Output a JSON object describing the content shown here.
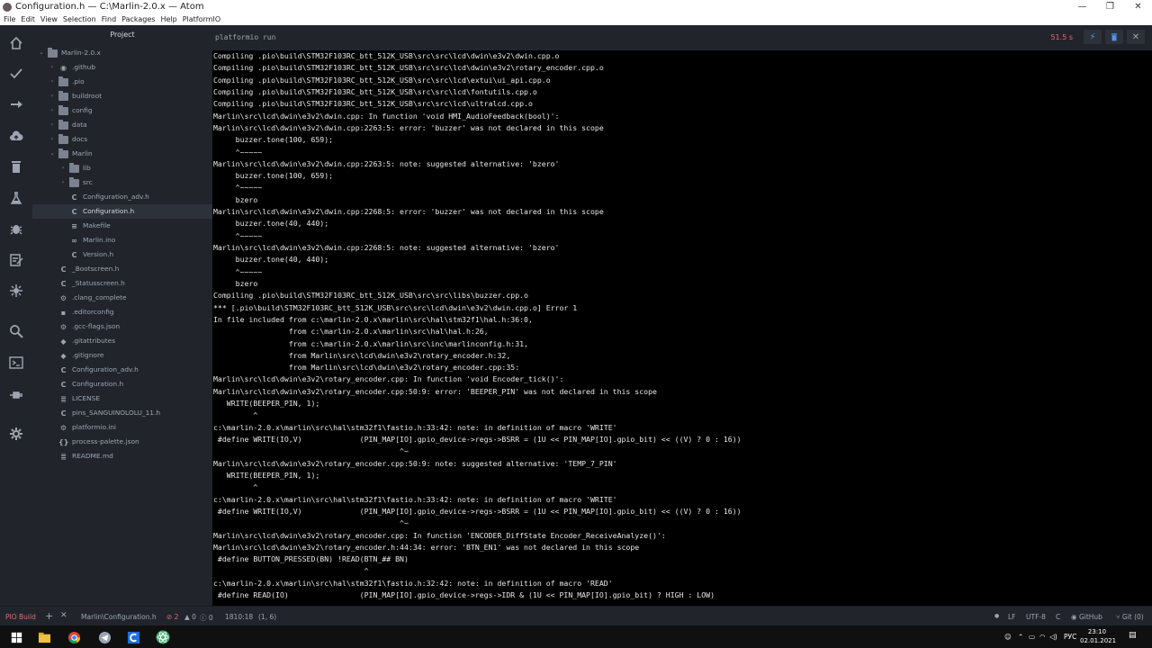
{
  "window": {
    "title": "Configuration.h — C:\\Marlin-2.0.x — Atom",
    "controls": {
      "minimize": "—",
      "maximize": "❐",
      "close": "✕"
    }
  },
  "menu": [
    "File",
    "Edit",
    "View",
    "Selection",
    "Find",
    "Packages",
    "Help",
    "PlatformIO"
  ],
  "activity_icons": [
    "home-icon",
    "check-icon",
    "arrow-right-icon",
    "cloud-upload-icon",
    "trash-icon",
    "flask-icon",
    "bug-icon",
    "checklist-icon",
    "plug-icon",
    "search-icon",
    "terminal-icon",
    "plug-icon",
    "gear-icon"
  ],
  "tree": {
    "header": "Project",
    "items": [
      {
        "label": "Marlin-2.0.x",
        "kind": "folder",
        "arrow": "⌄",
        "depth": 0
      },
      {
        "label": ".github",
        "kind": "github",
        "arrow": "›",
        "depth": 1
      },
      {
        "label": ".pio",
        "kind": "folder",
        "arrow": "›",
        "depth": 1
      },
      {
        "label": "buildroot",
        "kind": "folder",
        "arrow": "›",
        "depth": 1
      },
      {
        "label": "config",
        "kind": "folder",
        "arrow": "›",
        "depth": 1
      },
      {
        "label": "data",
        "kind": "folder",
        "arrow": "›",
        "depth": 1
      },
      {
        "label": "docs",
        "kind": "folder",
        "arrow": "›",
        "depth": 1
      },
      {
        "label": "Marlin",
        "kind": "folder",
        "arrow": "⌄",
        "depth": 1
      },
      {
        "label": "lib",
        "kind": "folder",
        "arrow": "›",
        "depth": 2
      },
      {
        "label": "src",
        "kind": "folder",
        "arrow": "›",
        "depth": 2
      },
      {
        "label": "Configuration_adv.h",
        "kind": "c",
        "depth": 2,
        "modified": true
      },
      {
        "label": "Configuration.h",
        "kind": "c",
        "depth": 2,
        "selected": true
      },
      {
        "label": "Makefile",
        "kind": "make",
        "depth": 2
      },
      {
        "label": "Marlin.ino",
        "kind": "ino",
        "depth": 2
      },
      {
        "label": "Version.h",
        "kind": "c",
        "depth": 2
      },
      {
        "label": "_Bootscreen.h",
        "kind": "c",
        "depth": 1
      },
      {
        "label": "_Statusscreen.h",
        "kind": "c",
        "depth": 1
      },
      {
        "label": ".clang_complete",
        "kind": "gear",
        "depth": 1
      },
      {
        "label": ".editorconfig",
        "kind": "file",
        "depth": 1
      },
      {
        "label": ".gcc-flags.json",
        "kind": "gear",
        "depth": 1
      },
      {
        "label": ".gitattributes",
        "kind": "git",
        "depth": 1
      },
      {
        "label": ".gitignore",
        "kind": "git",
        "depth": 1
      },
      {
        "label": "Configuration_adv.h",
        "kind": "c",
        "depth": 1
      },
      {
        "label": "Configuration.h",
        "kind": "c",
        "depth": 1
      },
      {
        "label": "LICENSE",
        "kind": "list",
        "depth": 1
      },
      {
        "label": "pins_SANGUINOLOLU_11.h",
        "kind": "c",
        "depth": 1
      },
      {
        "label": "platformio.ini",
        "kind": "gear",
        "depth": 1
      },
      {
        "label": "process-palette.json",
        "kind": "braces",
        "depth": 1
      },
      {
        "label": "README.md",
        "kind": "list",
        "depth": 1
      }
    ]
  },
  "terminal": {
    "title": "platformio run",
    "timer": "51.5 s",
    "lines": [
      "Compiling .pio\\build\\STM32F103RC_btt_512K_USB\\src\\src\\lcd\\dwin\\e3v2\\dwin.cpp.o",
      "Compiling .pio\\build\\STM32F103RC_btt_512K_USB\\src\\src\\lcd\\dwin\\e3v2\\rotary_encoder.cpp.o",
      "Compiling .pio\\build\\STM32F103RC_btt_512K_USB\\src\\src\\lcd\\extui\\ui_api.cpp.o",
      "Compiling .pio\\build\\STM32F103RC_btt_512K_USB\\src\\src\\lcd\\fontutils.cpp.o",
      "Compiling .pio\\build\\STM32F103RC_btt_512K_USB\\src\\src\\lcd\\ultralcd.cpp.o",
      "Marlin\\src\\lcd\\dwin\\e3v2\\dwin.cpp: In function 'void HMI_AudioFeedback(bool)':",
      "Marlin\\src\\lcd\\dwin\\e3v2\\dwin.cpp:2263:5: error: 'buzzer' was not declared in this scope",
      "     buzzer.tone(100, 659);",
      "     ^~~~~~",
      "Marlin\\src\\lcd\\dwin\\e3v2\\dwin.cpp:2263:5: note: suggested alternative: 'bzero'",
      "     buzzer.tone(100, 659);",
      "     ^~~~~~",
      "     bzero",
      "Marlin\\src\\lcd\\dwin\\e3v2\\dwin.cpp:2268:5: error: 'buzzer' was not declared in this scope",
      "     buzzer.tone(40, 440);",
      "     ^~~~~~",
      "Marlin\\src\\lcd\\dwin\\e3v2\\dwin.cpp:2268:5: note: suggested alternative: 'bzero'",
      "     buzzer.tone(40, 440);",
      "     ^~~~~~",
      "     bzero",
      "Compiling .pio\\build\\STM32F103RC_btt_512K_USB\\src\\src\\libs\\buzzer.cpp.o",
      "*** [.pio\\build\\STM32F103RC_btt_512K_USB\\src\\src\\lcd\\dwin\\e3v2\\dwin.cpp.o] Error 1",
      "In file included from c:\\marlin-2.0.x\\marlin\\src\\hal\\stm32f1\\hal.h:36:0,",
      "                 from c:\\marlin-2.0.x\\marlin\\src\\hal\\hal.h:26,",
      "                 from c:\\marlin-2.0.x\\marlin\\src\\inc\\marlinconfig.h:31,",
      "                 from Marlin\\src\\lcd\\dwin\\e3v2\\rotary_encoder.h:32,",
      "                 from Marlin\\src\\lcd\\dwin\\e3v2\\rotary_encoder.cpp:35:",
      "Marlin\\src\\lcd\\dwin\\e3v2\\rotary_encoder.cpp: In function 'void Encoder_tick()':",
      "Marlin\\src\\lcd\\dwin\\e3v2\\rotary_encoder.cpp:50:9: error: 'BEEPER_PIN' was not declared in this scope",
      "   WRITE(BEEPER_PIN, 1);",
      "         ^",
      "c:\\marlin-2.0.x\\marlin\\src\\hal\\stm32f1\\fastio.h:33:42: note: in definition of macro 'WRITE'",
      " #define WRITE(IO,V)             (PIN_MAP[IO].gpio_device->regs->BSRR = (1U << PIN_MAP[IO].gpio_bit) << ((V) ? 0 : 16))",
      "                                          ^~",
      "Marlin\\src\\lcd\\dwin\\e3v2\\rotary_encoder.cpp:50:9: note: suggested alternative: 'TEMP_7_PIN'",
      "   WRITE(BEEPER_PIN, 1);",
      "         ^",
      "c:\\marlin-2.0.x\\marlin\\src\\hal\\stm32f1\\fastio.h:33:42: note: in definition of macro 'WRITE'",
      " #define WRITE(IO,V)             (PIN_MAP[IO].gpio_device->regs->BSRR = (1U << PIN_MAP[IO].gpio_bit) << ((V) ? 0 : 16))",
      "                                          ^~",
      "Marlin\\src\\lcd\\dwin\\e3v2\\rotary_encoder.cpp: In function 'ENCODER_DiffState Encoder_ReceiveAnalyze()':",
      "Marlin\\src\\lcd\\dwin\\e3v2\\rotary_encoder.h:44:34: error: 'BTN_EN1' was not declared in this scope",
      " #define BUTTON_PRESSED(BN) !READ(BTN_## BN)",
      "                                  ^",
      "c:\\marlin-2.0.x\\marlin\\src\\hal\\stm32f1\\fastio.h:32:42: note: in definition of macro 'READ'",
      " #define READ(IO)                (PIN_MAP[IO].gpio_device->regs->IDR & (1U << PIN_MAP[IO].gpio_bit) ? HIGH : LOW)"
    ]
  },
  "status": {
    "pio_build": "PIO Build",
    "add": "+",
    "close": "✕",
    "file_path": "Marlin\\Configuration.h",
    "errors": "⊘ 2",
    "warnings": "▲ 0",
    "infos": "ⓘ 0",
    "position": "1810:18",
    "selection": "(1, 6)",
    "line_ending": "LF",
    "encoding": "UTF-8",
    "grammar": "C",
    "github": "GitHub",
    "git": "Git (0)"
  },
  "taskbar": {
    "language": "РУС",
    "time": "23:10",
    "date": "02.01.2021"
  }
}
